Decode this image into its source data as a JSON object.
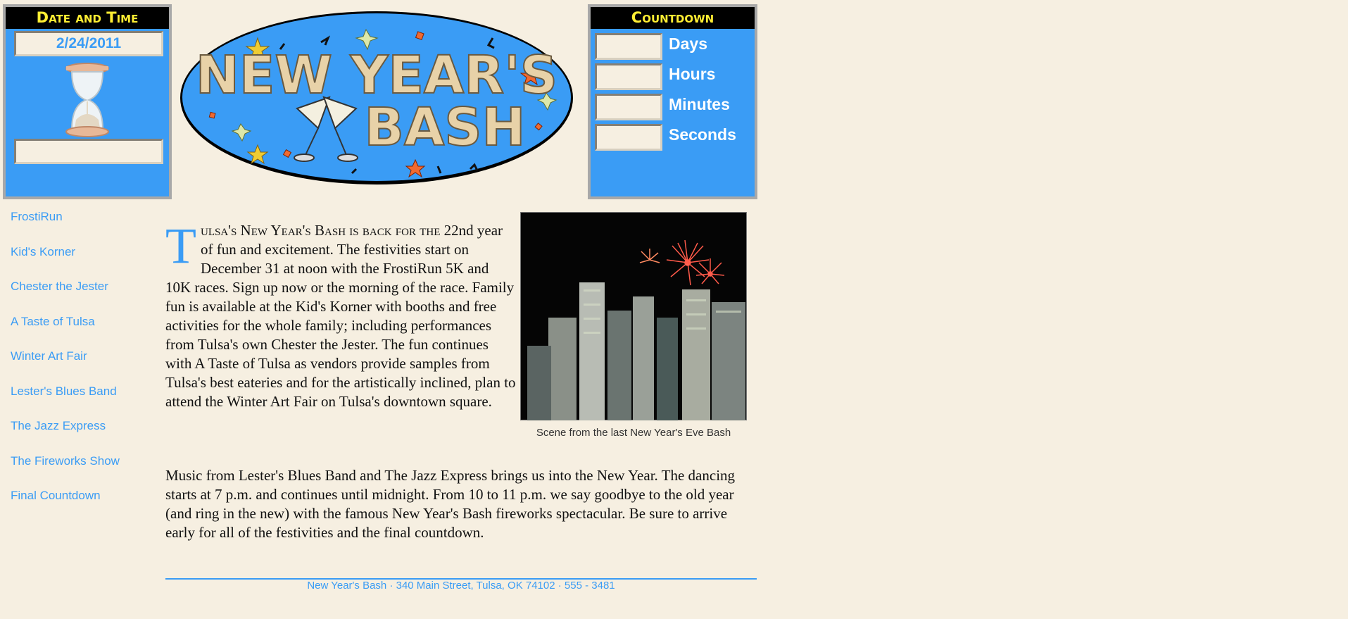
{
  "datetime": {
    "title": "Date and Time",
    "date": "2/24/2011",
    "time": ""
  },
  "logo": {
    "line1": "NEW YEAR'S",
    "line2": "BASH",
    "bg_color": "#3a9cf5"
  },
  "countdown": {
    "title": "Countdown",
    "rows": [
      {
        "label": "Days",
        "value": ""
      },
      {
        "label": "Hours",
        "value": ""
      },
      {
        "label": "Minutes",
        "value": ""
      },
      {
        "label": "Seconds",
        "value": ""
      }
    ]
  },
  "nav": {
    "items": [
      "FrostiRun",
      "Kid's Korner",
      "Chester the Jester",
      "A Taste of Tulsa",
      "Winter Art Fair",
      "Lester's Blues Band",
      "The Jazz Express",
      "The Fireworks Show",
      "Final Countdown"
    ]
  },
  "content": {
    "dropcap": "T",
    "intro_smallcaps": "ulsa's New Year's Bash is back for the",
    "para1_rest": " 22nd year of fun and excitement. The festivities start on December 31 at noon with the FrostiRun 5K and 10K races. Sign up now or the morning of the race. Family fun is available at the Kid's Korner with booths and free activities for the whole family; including performances from Tulsa's own Chester the Jester. The fun continues with A Taste of Tulsa as vendors provide samples from Tulsa's best eateries and for the artistically inclined, plan to attend the Winter Art Fair on Tulsa's downtown square.",
    "para2": "Music from Lester's Blues Band and The Jazz Express brings us into the New Year. The dancing starts at 7 p.m. and continues until midnight. From 10 to 11 p.m. we say goodbye to the old year (and ring in the new) with the famous New Year's Bash fireworks spectacular. Be sure to arrive early for all of the festivities and the final countdown.",
    "photo_caption": "Scene from the last New Year's Eve Bash"
  },
  "footer": {
    "text": "New Year's Bash · 340 Main Street, Tulsa, OK 74102 · 555 - 3481"
  },
  "colors": {
    "accent": "#3a9cf5",
    "background": "#f6efe1",
    "heading": "#ffee33"
  }
}
